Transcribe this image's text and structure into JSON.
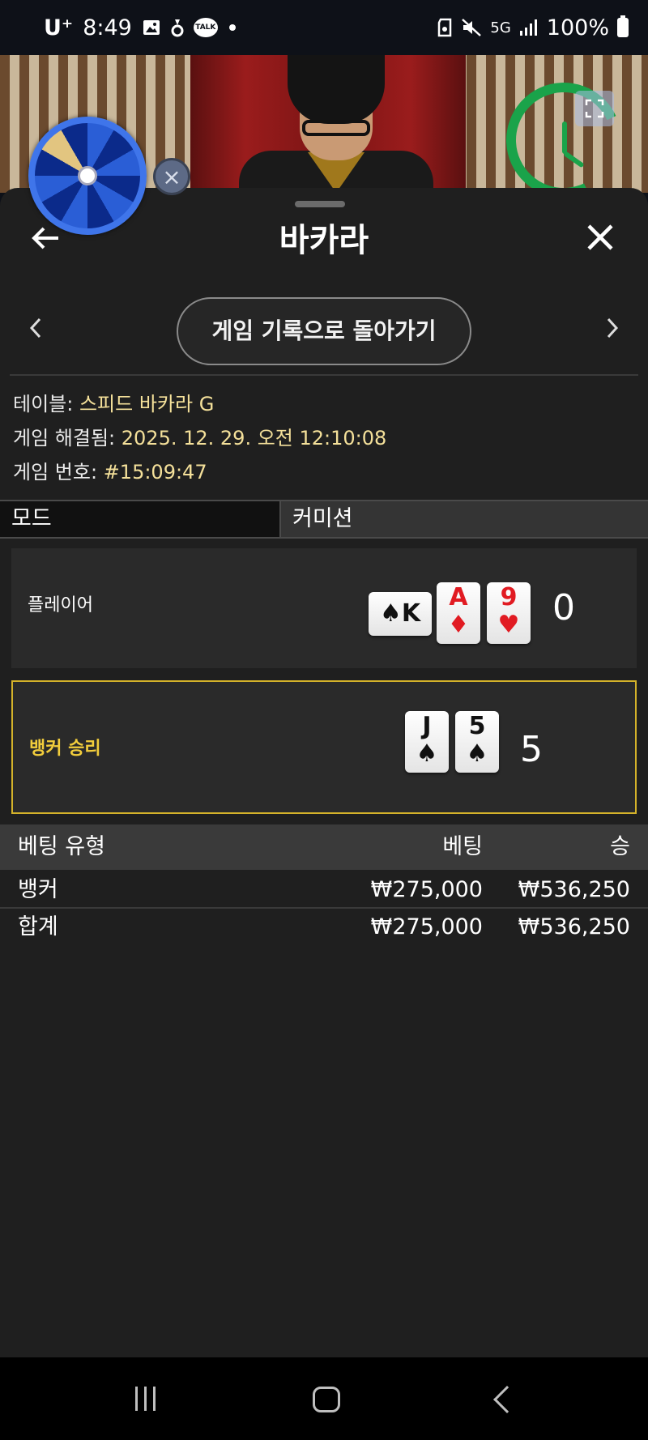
{
  "status_bar": {
    "carrier": "U⁺",
    "time": "8:49",
    "battery": "100%",
    "network": "5G",
    "icons": [
      "gallery-icon",
      "notification-icon",
      "kakaotalk-icon",
      "dot-icon",
      "sd-card-icon",
      "mute-icon",
      "signal-icon",
      "battery-icon"
    ],
    "talk_label": "TALK"
  },
  "panel": {
    "title": "바카라",
    "history_button": "게임 기록으로 돌아가기"
  },
  "info": {
    "table_label": "테이블:",
    "table_value": "스피드 바카라 G",
    "resolved_label": "게임 해결됨:",
    "resolved_value": "2025. 12. 29. 오전 12:10:08",
    "number_label": "게임 번호:",
    "number_value": "#15:09:47"
  },
  "tabs": {
    "mode": "모드",
    "commission": "커미션"
  },
  "player": {
    "label": "플레이어",
    "score": "0",
    "cards": [
      {
        "rank": "K",
        "suit": "♠",
        "color": "black",
        "rotated": true
      },
      {
        "rank": "A",
        "suit": "♦",
        "color": "red",
        "rotated": false
      },
      {
        "rank": "9",
        "suit": "♥",
        "color": "red",
        "rotated": false
      }
    ]
  },
  "banker": {
    "label": "뱅커 승리",
    "score": "5",
    "cards": [
      {
        "rank": "J",
        "suit": "♠",
        "color": "black",
        "rotated": false
      },
      {
        "rank": "5",
        "suit": "♠",
        "color": "black",
        "rotated": false
      }
    ]
  },
  "bets": {
    "headers": {
      "type": "베팅 유형",
      "bet": "베팅",
      "win": "승"
    },
    "rows": [
      {
        "type": "뱅커",
        "bet": "₩275,000",
        "win": "₩536,250"
      }
    ],
    "total": {
      "type": "합계",
      "bet": "₩275,000",
      "win": "₩536,250"
    }
  },
  "colors": {
    "panel_bg": "#1f1f1f",
    "highlight_border": "#d4b22a",
    "info_value": "#f4e09a",
    "timer_green": "#1aa34a"
  }
}
